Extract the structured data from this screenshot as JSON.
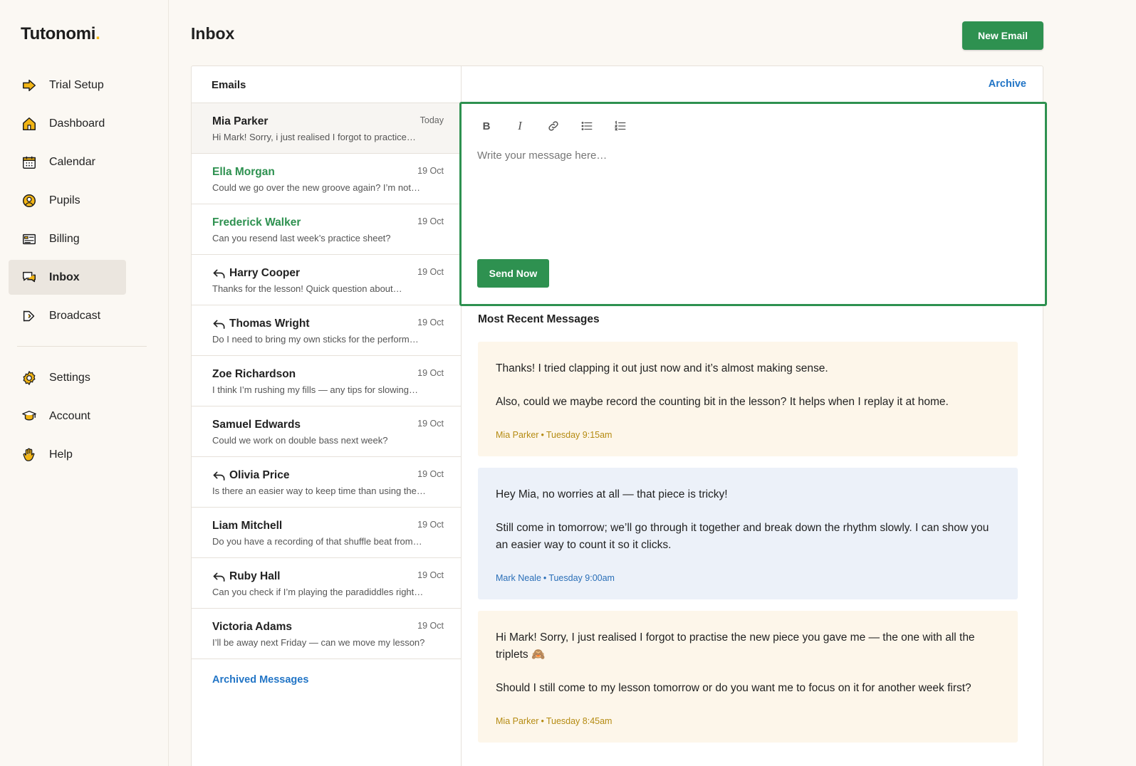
{
  "brand": {
    "name": "Tutonomi",
    "dot": ".",
    "dot_color": "#f2b515"
  },
  "accent_color": "#2e9150",
  "link_color": "#2275c6",
  "sidebar": {
    "items": [
      {
        "label": "Trial Setup",
        "icon": "arrow-right-icon"
      },
      {
        "label": "Dashboard",
        "icon": "home-icon"
      },
      {
        "label": "Calendar",
        "icon": "calendar-icon"
      },
      {
        "label": "Pupils",
        "icon": "user-circle-icon"
      },
      {
        "label": "Billing",
        "icon": "billing-icon"
      },
      {
        "label": "Inbox",
        "icon": "chat-icon",
        "active": true
      },
      {
        "label": "Broadcast",
        "icon": "megaphone-icon"
      }
    ],
    "secondary": [
      {
        "label": "Settings",
        "icon": "gear-icon"
      },
      {
        "label": "Account",
        "icon": "graduation-cap-icon"
      },
      {
        "label": "Help",
        "icon": "hand-wave-icon"
      }
    ]
  },
  "header": {
    "title": "Inbox",
    "new_email_label": "New Email"
  },
  "emails": {
    "title": "Emails",
    "items": [
      {
        "name": "Mia Parker",
        "date": "Today",
        "preview": "Hi Mark! Sorry, i just realised I forgot to practice…",
        "status": "selected"
      },
      {
        "name": "Ella Morgan",
        "date": "19 Oct",
        "preview": "Could we go over the new groove again? I’m not…",
        "status": "unread"
      },
      {
        "name": "Frederick Walker",
        "date": "19 Oct",
        "preview": "Can you resend last week’s practice sheet?",
        "status": "unread"
      },
      {
        "name": "Harry Cooper",
        "date": "19 Oct",
        "preview": "Thanks for the lesson! Quick question about…",
        "status": "replied"
      },
      {
        "name": "Thomas Wright",
        "date": "19 Oct",
        "preview": "Do I need to bring my own sticks for the perform…",
        "status": "replied"
      },
      {
        "name": "Zoe Richardson",
        "date": "19 Oct",
        "preview": "I think I’m rushing my fills — any tips for slowing…",
        "status": "read"
      },
      {
        "name": "Samuel Edwards",
        "date": "19 Oct",
        "preview": "Could we work on double bass next week?",
        "status": "read"
      },
      {
        "name": "Olivia Price",
        "date": "19 Oct",
        "preview": "Is there an easier way to keep time than using the…",
        "status": "replied"
      },
      {
        "name": "Liam Mitchell",
        "date": "19 Oct",
        "preview": "Do you have a recording of that shuffle beat from…",
        "status": "read"
      },
      {
        "name": "Ruby Hall",
        "date": "19 Oct",
        "preview": "Can you check if I’m playing the paradiddles right…",
        "status": "replied"
      },
      {
        "name": "Victoria Adams",
        "date": "19 Oct",
        "preview": "I’ll be away next Friday — can we move my lesson?",
        "status": "read"
      }
    ],
    "archived_label": "Archived Messages"
  },
  "detail": {
    "archive_label": "Archive",
    "composer": {
      "placeholder": "Write your message here…",
      "value": "",
      "send_label": "Send Now",
      "toolbar": [
        "bold-icon",
        "italic-icon",
        "link-icon",
        "bullet-list-icon",
        "numbered-list-icon"
      ]
    },
    "recent_title": "Most Recent Messages",
    "messages": [
      {
        "direction": "in",
        "paragraphs": [
          "Thanks! I tried clapping it out just now and it’s almost making sense.",
          "Also, could we maybe record the counting bit in the lesson? It helps when I replay it at home."
        ],
        "sender": "Mia Parker",
        "time": "Tuesday 9:15am"
      },
      {
        "direction": "out",
        "paragraphs": [
          "Hey Mia, no worries at all — that piece is tricky!",
          "Still come in tomorrow; we’ll go through it together and break down the rhythm slowly. I can show you an easier way to count it so it clicks."
        ],
        "sender": "Mark Neale",
        "time": "Tuesday 9:00am"
      },
      {
        "direction": "in",
        "paragraphs": [
          "Hi Mark! Sorry, I just realised I forgot to practise the new piece you gave me — the one with all the triplets 🙈",
          "Should I still come to my lesson tomorrow or do you want me to focus on it for another week first?"
        ],
        "sender": "Mia Parker",
        "time": "Tuesday 8:45am"
      }
    ]
  }
}
